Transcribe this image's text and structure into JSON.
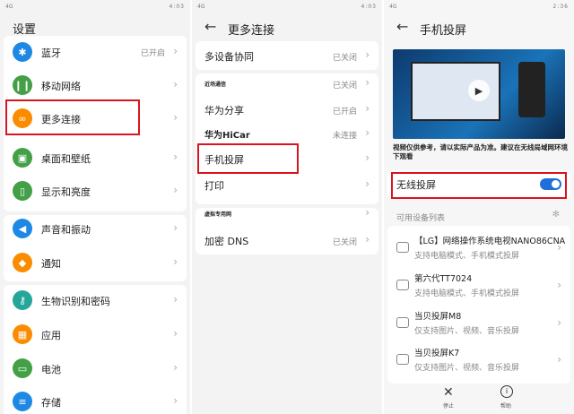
{
  "panel1": {
    "status": {
      "left": "4G",
      "time": "4:03"
    },
    "title": "设置",
    "items": [
      {
        "label": "蓝牙",
        "value": "已开启",
        "color": "#1e88e5",
        "icon": "bluetooth-icon",
        "glyph": "✱"
      },
      {
        "label": "移动网络",
        "value": "",
        "color": "#43a047",
        "icon": "signal-icon",
        "glyph": "❙❙"
      },
      {
        "label": "更多连接",
        "value": "",
        "color": "#fb8c00",
        "icon": "link-icon",
        "glyph": "∞"
      },
      {
        "label": "桌面和壁纸",
        "value": "",
        "color": "#43a047",
        "icon": "wallpaper-icon",
        "glyph": "▣"
      },
      {
        "label": "显示和亮度",
        "value": "",
        "color": "#43a047",
        "icon": "display-icon",
        "glyph": "▯"
      },
      {
        "label": "声音和振动",
        "value": "",
        "color": "#1e88e5",
        "icon": "sound-icon",
        "glyph": "◀"
      },
      {
        "label": "通知",
        "value": "",
        "color": "#fb8c00",
        "icon": "bell-icon",
        "glyph": "◆"
      },
      {
        "label": "生物识别和密码",
        "value": "",
        "color": "#26a69a",
        "icon": "key-icon",
        "glyph": "⚷"
      },
      {
        "label": "应用",
        "value": "",
        "color": "#fb8c00",
        "icon": "apps-icon",
        "glyph": "▦"
      },
      {
        "label": "电池",
        "value": "",
        "color": "#43a047",
        "icon": "battery-icon",
        "glyph": "▭"
      },
      {
        "label": "存储",
        "value": "",
        "color": "#1e88e5",
        "icon": "storage-icon",
        "glyph": "≡"
      }
    ]
  },
  "panel2": {
    "status": {
      "left": "4G",
      "time": "4:03"
    },
    "title": "更多连接",
    "items": [
      {
        "label": "多设备协同",
        "value": "已关闭",
        "style": ""
      },
      {
        "label": "近场通信",
        "value": "已关闭",
        "style": "tiny"
      },
      {
        "label": "华为分享",
        "value": "已开启",
        "style": ""
      },
      {
        "label": "华为HiCar",
        "value": "未连接",
        "style": "bold"
      },
      {
        "label": "手机投屏",
        "value": "",
        "style": ""
      },
      {
        "label": "打印",
        "value": "",
        "style": ""
      },
      {
        "label": "虚拟专用网",
        "value": "",
        "style": "tiny"
      },
      {
        "label": "加密 DNS",
        "value": "已关闭",
        "style": ""
      }
    ]
  },
  "panel3": {
    "status": {
      "left": "4G",
      "time": "2:36"
    },
    "title": "手机投屏",
    "video_note": "视频仅供参考，请以实际产品为准。建议在无线局域网环境下观看",
    "wireless_label": "无线投屏",
    "wireless_on": true,
    "devices_header": "可用设备列表",
    "devices": [
      {
        "name": "【LG】网络操作系统电视NANO86CNA",
        "sub": "支持电脑模式、手机模式投屏"
      },
      {
        "name": "第六代TT7024",
        "sub": "支持电脑模式、手机模式投屏"
      },
      {
        "name": "当贝投屏M8",
        "sub": "仅支持图片、视频、音乐投屏"
      },
      {
        "name": "当贝投屏K7",
        "sub": "仅支持图片、视频、音乐投屏"
      }
    ],
    "bottom": {
      "stop": "停止",
      "help": "帮助"
    }
  }
}
